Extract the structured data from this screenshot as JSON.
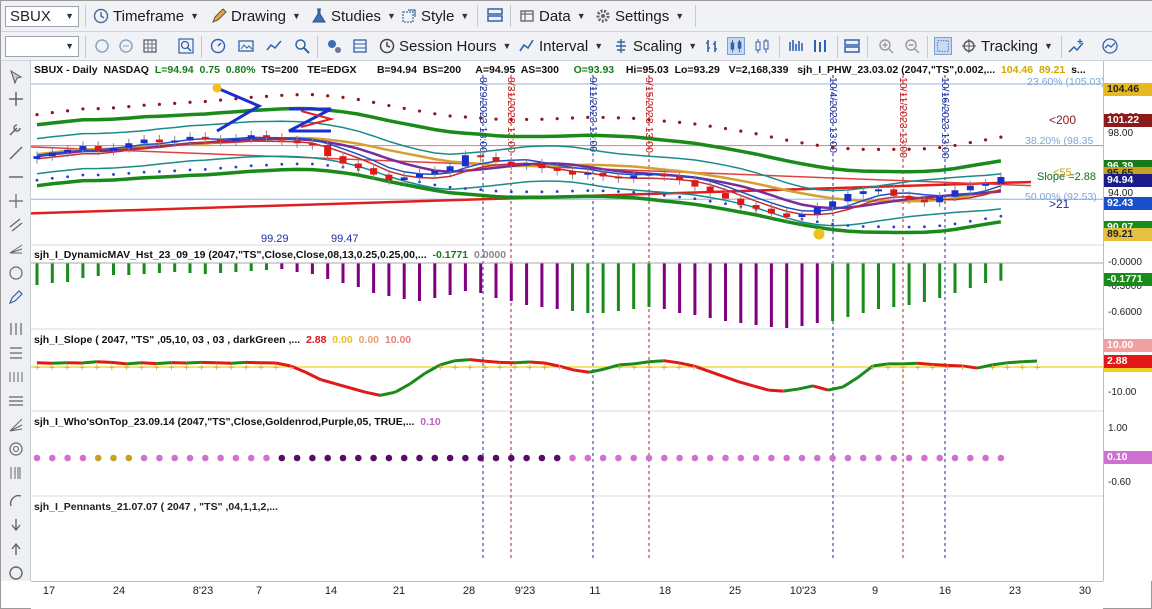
{
  "toolbar1": {
    "symbol": "SBUX",
    "timeframe": "Timeframe",
    "drawing": "Drawing",
    "studies": "Studies",
    "style": "Style",
    "data": "Data",
    "settings": "Settings"
  },
  "toolbar2": {
    "session_hours": "Session Hours",
    "interval": "Interval",
    "scaling": "Scaling",
    "tracking": "Tracking"
  },
  "price_header": {
    "symbol": "SBUX - Daily",
    "exchange": "NASDAQ",
    "last": "L=94.94",
    "change": "0.75",
    "pct": "0.80%",
    "ts": "TS=200",
    "te": "TE=EDGX",
    "bid": "B=94.94",
    "bs": "BS=200",
    "ask": "A=94.95",
    "as": "AS=300",
    "open": "O=93.93",
    "hi": "Hi=95.03",
    "lo": "Lo=93.29",
    "vol": "V=2,168,339",
    "study": "sjh_I_PHW_23.03.02 (2047,\"TS\",0.002,...",
    "v1": "104.46",
    "v2": "89.21",
    "tail": "s..."
  },
  "price_labels": {
    "lt200": "<200",
    "fib382": "38.20% (98.35",
    "fib236": "23.60% (105.03)",
    "fib50": "50.00% (92.53)",
    "slope": "Slope =2.88",
    "lt55": "<55",
    "gt21": ">21",
    "peak1": "99.29",
    "peak2": "99.47"
  },
  "date_lines": [
    {
      "label": "8/29/2023 13:00",
      "color": "#1a2fa0"
    },
    {
      "label": "8/31/2023 13:00",
      "color": "#c01818"
    },
    {
      "label": "9/11/2023 13:00",
      "color": "#1a2fa0"
    },
    {
      "label": "9/15/2023 13:00",
      "color": "#c01818"
    },
    {
      "label": "10/4/2023 13:00",
      "color": "#1a2fa0"
    },
    {
      "label": "10/11/2023 13:00",
      "color": "#c01818"
    },
    {
      "label": "10/16/2023 13:00",
      "color": "#1a2fa0"
    }
  ],
  "panes": {
    "mav": {
      "title": "sjh_I_DynamicMAV_Hst_23_09_19 (2047,\"TS\",Close,Close,08,13,0.25,0.25,00,...",
      "v1": "-0.1771",
      "v2": "0.0000"
    },
    "slope": {
      "title": "sjh_I_Slope ( 2047, \"TS\" ,05,10, 03 , 03 , darkGreen ,...",
      "v1": "2.88",
      "v2": "0.00",
      "v3": "0.00",
      "v4": "10.00"
    },
    "who": {
      "title": "sjh_I_Who'sOnTop_23.09.14 (2047,\"TS\",Close,Goldenrod,Purple,05,  TRUE,...",
      "v1": "0.10"
    },
    "pennants": {
      "title": "sjh_I_Pennants_21.07.07 (  2047 ,  \"TS\" ,04,1,1,2,..."
    }
  },
  "axis": {
    "price_ticks": [
      "102.00",
      "98.00",
      "94.00"
    ],
    "price_boxes": [
      {
        "text": "104.46",
        "bg": "#e8b820",
        "fg": "#222"
      },
      {
        "text": "101.22",
        "bg": "#8b1a1a",
        "fg": "#fff"
      },
      {
        "text": "96.39",
        "bg": "#1a7a1a",
        "fg": "#fff"
      },
      {
        "text": "95.65",
        "bg": "#c8a020",
        "fg": "#222"
      },
      {
        "text": "94.94",
        "bg": "#1a1a8a",
        "fg": "#fff"
      },
      {
        "text": "92.43",
        "bg": "#1a4fcc",
        "fg": "#fff"
      },
      {
        "text": "90.07",
        "bg": "#1a8a1a",
        "fg": "#fff"
      },
      {
        "text": "89.21",
        "bg": "#e8c040",
        "fg": "#222"
      }
    ],
    "mav_ticks": [
      "-0.0000",
      "-0.3000",
      "-0.6000"
    ],
    "mav_box": "-0.1771",
    "slope_ticks": [
      "10.00",
      "-10.00"
    ],
    "slope_boxes": [
      "10.00",
      "2.88"
    ],
    "who_ticks": [
      "1.00",
      "-0.60"
    ],
    "who_box": "0.10"
  },
  "x_axis": [
    {
      "label": "17"
    },
    {
      "label": "24"
    },
    {
      "label": "8'23"
    },
    {
      "label": "7"
    },
    {
      "label": "14"
    },
    {
      "label": "21"
    },
    {
      "label": "28"
    },
    {
      "label": "9'23"
    },
    {
      "label": "11"
    },
    {
      "label": "18"
    },
    {
      "label": "25"
    },
    {
      "label": "10'23"
    },
    {
      "label": "9"
    },
    {
      "label": "16"
    },
    {
      "label": "23"
    },
    {
      "label": "30"
    }
  ],
  "chart_data": {
    "type": "candlestick",
    "title": "SBUX - Daily",
    "closes": [
      97.2,
      97.6,
      97.9,
      98.3,
      97.8,
      98.1,
      98.6,
      99.0,
      98.7,
      98.9,
      99.29,
      99.0,
      98.8,
      99.1,
      99.47,
      99.2,
      98.9,
      98.6,
      98.4,
      97.2,
      96.4,
      95.9,
      95.2,
      94.6,
      94.9,
      95.3,
      95.6,
      96.1,
      97.3,
      97.1,
      96.6,
      96.2,
      96.4,
      95.9,
      95.6,
      95.2,
      95.4,
      95.0,
      94.8,
      95.1,
      95.3,
      95.0,
      94.6,
      93.9,
      93.2,
      92.6,
      91.9,
      91.5,
      91.0,
      90.6,
      90.9,
      91.7,
      92.3,
      93.1,
      93.4,
      93.6,
      92.9,
      92.5,
      92.2,
      92.8,
      93.5,
      94.0,
      94.2,
      94.94
    ],
    "mav_values": [
      -0.22,
      -0.2,
      -0.19,
      -0.15,
      -0.13,
      -0.12,
      -0.12,
      -0.11,
      -0.1,
      -0.09,
      -0.1,
      -0.11,
      -0.1,
      -0.09,
      -0.08,
      -0.07,
      -0.06,
      -0.09,
      -0.11,
      -0.16,
      -0.2,
      -0.24,
      -0.3,
      -0.33,
      -0.36,
      -0.38,
      -0.35,
      -0.32,
      -0.28,
      -0.3,
      -0.35,
      -0.38,
      -0.42,
      -0.44,
      -0.46,
      -0.48,
      -0.5,
      -0.5,
      -0.48,
      -0.46,
      -0.44,
      -0.46,
      -0.5,
      -0.52,
      -0.55,
      -0.58,
      -0.6,
      -0.62,
      -0.64,
      -0.65,
      -0.63,
      -0.6,
      -0.58,
      -0.54,
      -0.5,
      -0.46,
      -0.44,
      -0.42,
      -0.39,
      -0.35,
      -0.3,
      -0.25,
      -0.2,
      -0.1771
    ],
    "slope_values": [
      2.0,
      1.8,
      2.0,
      1.9,
      2.5,
      2.2,
      1.5,
      2.0,
      1.6,
      2.1,
      1.9,
      2.2,
      2.0,
      1.8,
      2.2,
      2.0,
      1.9,
      0.5,
      -2.5,
      -6.0,
      -8.0,
      -10.0,
      -12.0,
      -13.5,
      -12.0,
      -8.0,
      -3.0,
      1.0,
      3.0,
      3.5,
      2.8,
      2.2,
      2.0,
      2.4,
      1.9,
      0.4,
      -1.5,
      -2.5,
      -1.0,
      1.0,
      1.5,
      2.5,
      3.0,
      2.0,
      0.5,
      -2.0,
      -4.5,
      -7.0,
      -9.0,
      -11.0,
      -11.5,
      -10.5,
      -9.0,
      -11.0,
      -9.5,
      -5.0,
      0.5,
      1.5,
      1.5,
      1.8,
      1.2,
      0.8,
      0.5,
      -0.5,
      1.0,
      2.0,
      2.5,
      2.88
    ],
    "ylim": [
      88,
      106
    ]
  }
}
